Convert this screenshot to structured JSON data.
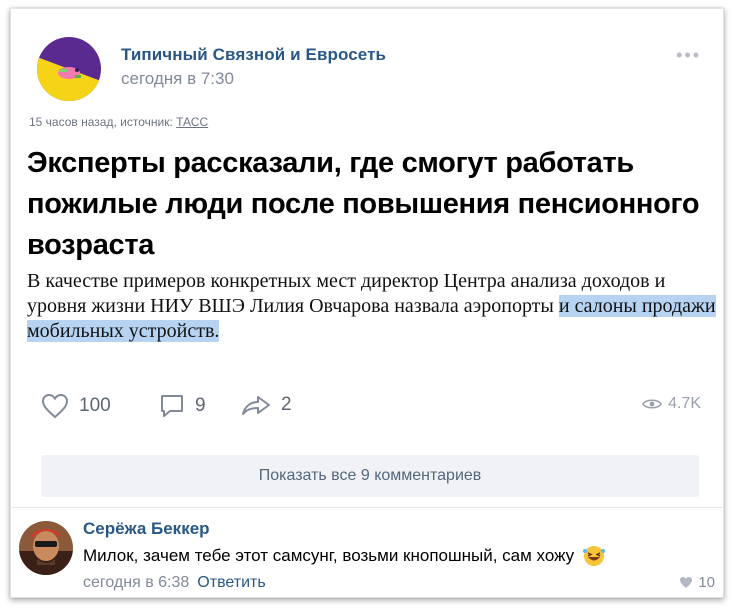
{
  "post": {
    "group_name": "Типичный Связной и Евросеть",
    "time": "сегодня в 7:30",
    "time_icon": "apple-icon",
    "more": "•••",
    "source_prefix": "15 часов назад, источник: ",
    "source_link": "ТАСС",
    "headline": "Эксперты рассказали, где смогут работать пожилые люди после повышения пенсионного возраста",
    "body_plain": "В качестве примеров конкретных мест директор Центра анализа доходов и уровня жизни НИУ ВШЭ Лилия Овчарова назвала аэропорты ",
    "body_highlighted": "и салоны продажи мобильных устройств.",
    "highlight_color": "#b6d4f2",
    "likes": "100",
    "comments": "9",
    "shares": "2",
    "views": "4.7K",
    "show_comments_label": "Показать все 9 комментариев"
  },
  "comment": {
    "author": "Серёжа Беккер",
    "text": "Милок, зачем тебе этот самсунг, возьми кнопошный, сам хожу",
    "emoji": "rofl-emoji-icon",
    "time": "сегодня в 6:38",
    "reply_label": "Ответить",
    "likes": "10"
  },
  "colors": {
    "link_blue": "#2a5885",
    "meta_gray": "#828a99",
    "avatar_purple": "#5b2a91",
    "avatar_yellow": "#f5d418"
  }
}
